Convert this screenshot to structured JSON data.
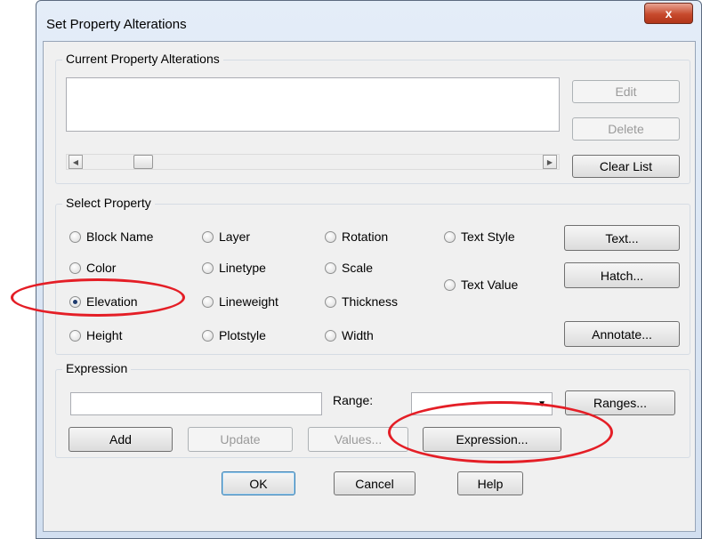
{
  "window": {
    "title": "Set Property Alterations",
    "close_glyph": "x"
  },
  "current_group": {
    "legend": "Current Property Alterations",
    "edit_label": "Edit",
    "delete_label": "Delete",
    "clear_list_label": "Clear List"
  },
  "select_group": {
    "legend": "Select Property",
    "radios": {
      "block_name": "Block Name",
      "color": "Color",
      "elevation": "Elevation",
      "height": "Height",
      "layer": "Layer",
      "linetype": "Linetype",
      "lineweight": "Lineweight",
      "plotstyle": "Plotstyle",
      "rotation": "Rotation",
      "scale": "Scale",
      "thickness": "Thickness",
      "width": "Width",
      "text_style": "Text Style",
      "text_value": "Text Value"
    },
    "selected": "elevation",
    "text_button": "Text...",
    "hatch_button": "Hatch...",
    "annotate_button": "Annotate..."
  },
  "expression_group": {
    "legend": "Expression",
    "expression_value": "",
    "range_label": "Range:",
    "range_value": "",
    "ranges_button": "Ranges...",
    "add_button": "Add",
    "update_button": "Update",
    "values_button": "Values...",
    "expression_button": "Expression..."
  },
  "footer": {
    "ok_label": "OK",
    "cancel_label": "Cancel",
    "help_label": "Help"
  },
  "colors": {
    "annotation_red": "#e41e26",
    "close_button_red": "#c74a2d",
    "title_bar_blue": "#d2dff0",
    "dialog_background": "#f0f0f0"
  }
}
